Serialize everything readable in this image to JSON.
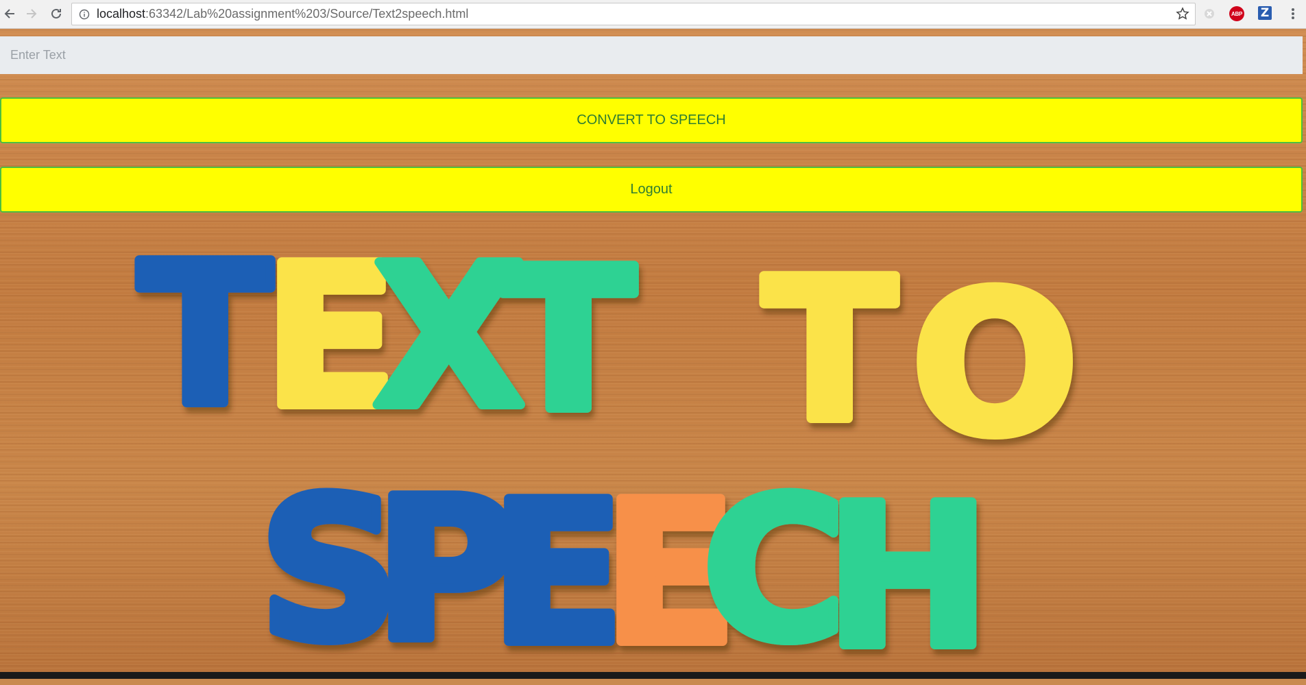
{
  "browser": {
    "url_host": "localhost",
    "url_rest": ":63342/Lab%20assignment%203/Source/Text2speech.html",
    "extensions": {
      "abp_label": "ABP",
      "z_label": "Z"
    },
    "icons": [
      "back-icon",
      "forward-icon",
      "reload-icon",
      "info-icon",
      "star-icon",
      "extension-icon",
      "abp-icon",
      "z-icon",
      "menu-icon"
    ]
  },
  "form": {
    "input_placeholder": "Enter Text",
    "input_value": "",
    "convert_label": "CONVERT TO SPEECH",
    "logout_label": "Logout"
  },
  "hero": {
    "line1_word1": "TEXT",
    "line1_word2": "TO",
    "line2_word": "SPEECH",
    "colors": {
      "blue": "#1b5fb5",
      "yellow": "#fbe34a",
      "green": "#2fd293",
      "orange": "#f7904a"
    }
  },
  "colors": {
    "button_bg": "#ffff00",
    "button_border": "#4cbe3f",
    "button_text": "#2f7d32",
    "input_bg": "#e9ecef"
  }
}
